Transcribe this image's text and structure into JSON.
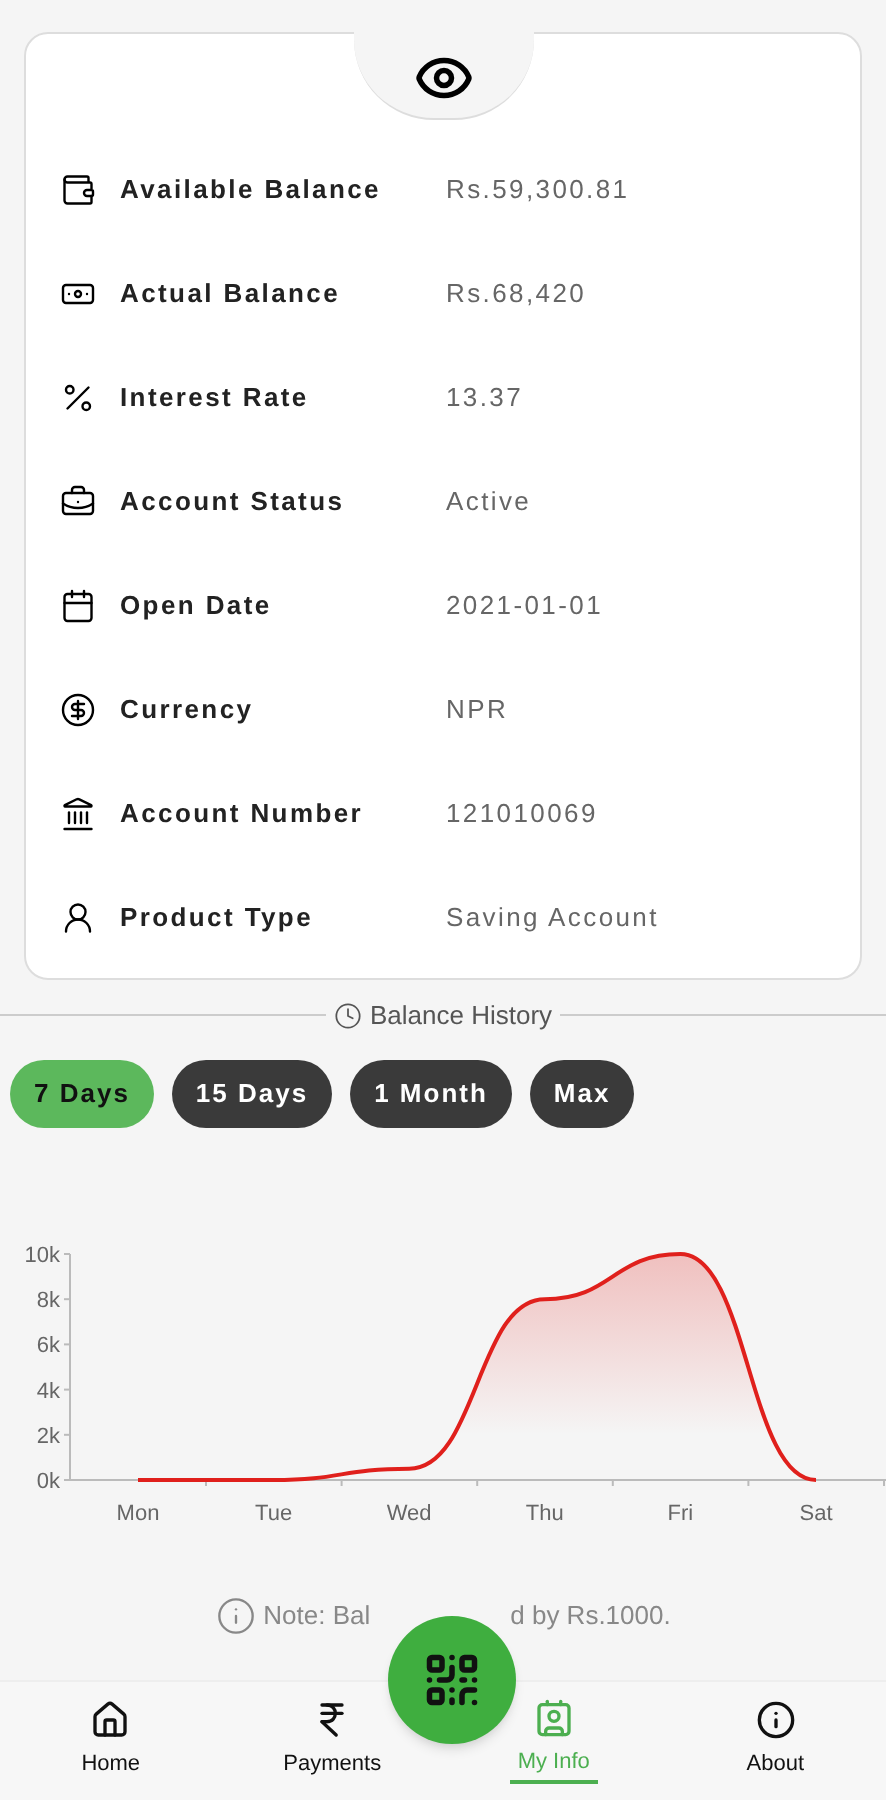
{
  "details": [
    {
      "label": "Available Balance",
      "value": "Rs.59,300.81"
    },
    {
      "label": "Actual Balance",
      "value": "Rs.68,420"
    },
    {
      "label": "Interest Rate",
      "value": "13.37"
    },
    {
      "label": "Account Status",
      "value": "Active"
    },
    {
      "label": "Open Date",
      "value": "2021-01-01"
    },
    {
      "label": "Currency",
      "value": "NPR"
    },
    {
      "label": "Account Number",
      "value": "121010069"
    },
    {
      "label": "Product Type",
      "value": "Saving Account"
    }
  ],
  "history_title": "Balance History",
  "ranges": [
    {
      "label": "7 Days",
      "selected": true
    },
    {
      "label": "15 Days",
      "selected": false
    },
    {
      "label": "1 Month",
      "selected": false
    },
    {
      "label": "Max",
      "selected": false
    }
  ],
  "chart_data": {
    "type": "area",
    "categories": [
      "Mon",
      "Tue",
      "Wed",
      "Thu",
      "Fri",
      "Sat"
    ],
    "series": [
      {
        "color": "#e0201c",
        "values": [
          0,
          0,
          500,
          8000,
          10000,
          0
        ]
      }
    ],
    "ylim": [
      0,
      10000
    ],
    "yticks": [
      {
        "value": 0,
        "label": "0k"
      },
      {
        "value": 2000,
        "label": "2k"
      },
      {
        "value": 4000,
        "label": "4k"
      },
      {
        "value": 6000,
        "label": "6k"
      },
      {
        "value": 8000,
        "label": "8k"
      },
      {
        "value": 10000,
        "label": "10k"
      }
    ]
  },
  "note": [
    "Note: Bal",
    "d by Rs.1000."
  ],
  "nav": [
    {
      "label": "Home",
      "selected": false
    },
    {
      "label": "Payments",
      "selected": false
    },
    {
      "label": "My Info",
      "selected": true
    },
    {
      "label": "About",
      "selected": false
    }
  ]
}
